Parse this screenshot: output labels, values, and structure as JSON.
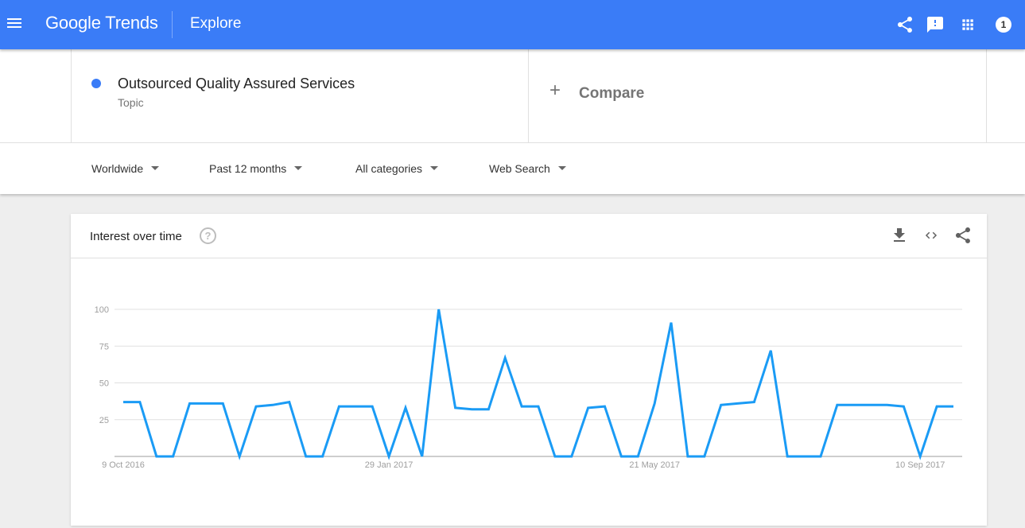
{
  "app": {
    "logo_google": "Google",
    "logo_trends": "Trends",
    "page_title": "Explore",
    "header_icons": [
      "share-icon",
      "feedback-icon",
      "apps-grid-icon"
    ],
    "account_badge": "1",
    "colors": {
      "appbar": "#3a7cf7",
      "series": "#1a9bf5",
      "term_dot": "#3a7cf7"
    }
  },
  "search": {
    "term": {
      "name": "Outsourced Quality Assured Services",
      "type": "Topic"
    },
    "compare": {
      "icon": "+",
      "label": "Compare"
    }
  },
  "filters": [
    {
      "label": "Worldwide"
    },
    {
      "label": "Past 12 months"
    },
    {
      "label": "All categories"
    },
    {
      "label": "Web Search"
    }
  ],
  "card": {
    "title": "Interest over time",
    "help_icon": "?",
    "actions": [
      "download-icon",
      "embed-code-icon",
      "share-icon"
    ]
  },
  "chart_data": {
    "type": "line",
    "title": "Interest over time",
    "xlabel": "",
    "ylabel": "",
    "ylim": [
      0,
      100
    ],
    "yticks": [
      25,
      50,
      75,
      100
    ],
    "grid": true,
    "legend": "none",
    "xtick_labels": [
      {
        "index": 0,
        "label": "9 Oct 2016"
      },
      {
        "index": 16,
        "label": "29 Jan 2017"
      },
      {
        "index": 32,
        "label": "21 May 2017"
      },
      {
        "index": 48,
        "label": "10 Sep 2017"
      }
    ],
    "series": [
      {
        "name": "Outsourced Quality Assured Services",
        "color": "#1a9bf5",
        "values": [
          37,
          37,
          0,
          0,
          36,
          36,
          36,
          0,
          34,
          35,
          37,
          0,
          0,
          34,
          34,
          34,
          0,
          33,
          0,
          100,
          33,
          32,
          32,
          67,
          34,
          34,
          0,
          0,
          33,
          34,
          0,
          0,
          36,
          91,
          0,
          0,
          35,
          36,
          37,
          72,
          0,
          0,
          0,
          35,
          35,
          35,
          35,
          34,
          0,
          34,
          34
        ]
      }
    ]
  }
}
